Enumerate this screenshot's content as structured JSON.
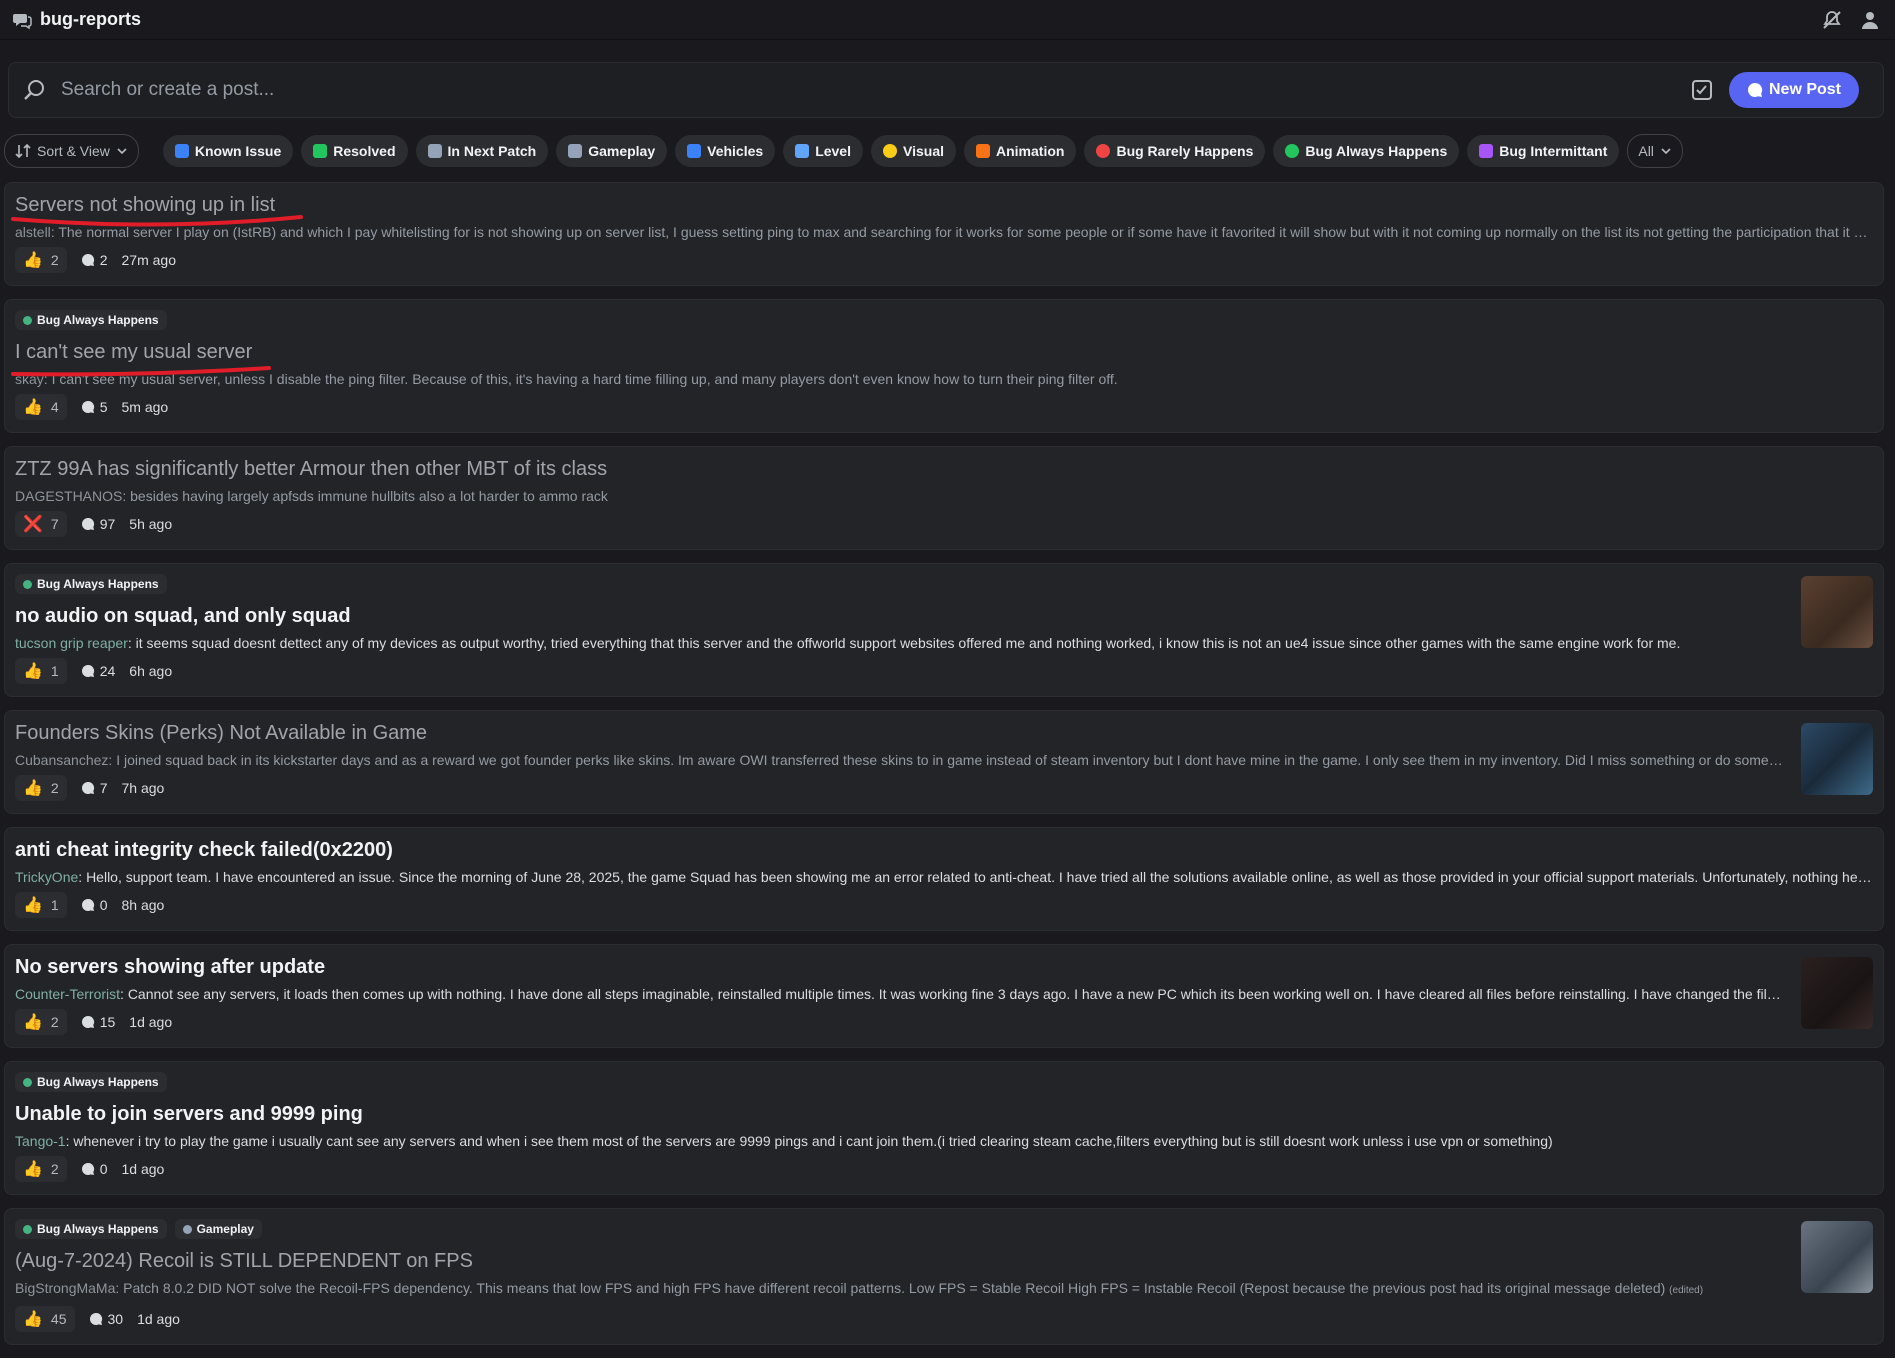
{
  "header": {
    "channel": "bug-reports",
    "icons": [
      "forum-icon",
      "mute-icon",
      "members-icon"
    ]
  },
  "search": {
    "placeholder": "Search or create a post...",
    "new_post_label": "New Post"
  },
  "sort_label": "Sort & View",
  "tags": [
    {
      "label": "Known Issue",
      "icon": "info-icon",
      "color": "#3b82f6"
    },
    {
      "label": "Resolved",
      "icon": "check-icon",
      "color": "#22c55e"
    },
    {
      "label": "In Next Patch",
      "icon": "patch-icon",
      "color": "#94a3b8"
    },
    {
      "label": "Gameplay",
      "icon": "dots-icon",
      "color": "#94a3b8"
    },
    {
      "label": "Vehicles",
      "icon": "vehicle-icon",
      "color": "#3b82f6"
    },
    {
      "label": "Level",
      "icon": "map-icon",
      "color": "#60a5fa"
    },
    {
      "label": "Visual",
      "icon": "bulb-icon",
      "color": "#facc15"
    },
    {
      "label": "Animation",
      "icon": "animation-icon",
      "color": "#f97316"
    },
    {
      "label": "Bug Rarely Happens",
      "icon": "red-bug-icon",
      "color": "#ef4444"
    },
    {
      "label": "Bug Always Happens",
      "icon": "green-bug-icon",
      "color": "#22c55e"
    },
    {
      "label": "Bug Intermittant",
      "icon": "worm-icon",
      "color": "#a855f7"
    }
  ],
  "all_label": "All",
  "posts": [
    {
      "tags": [],
      "title": "Servers not showing up in list",
      "dim": true,
      "author": "alstell",
      "preview": "The normal server I play on (IstRB) and which I pay whitelisting for is not showing up on server list, I guess setting ping to max and searching for it works for some people or if some have it favorited it will show but with it not coming up normally on the list its not getting the participation that it usually d...",
      "reaction": "👍",
      "reaction_count": "2",
      "comments": "2",
      "time": "27m ago",
      "thumb": null,
      "underline": true
    },
    {
      "tags": [
        "Bug Always Happens"
      ],
      "title": "I can't see my usual server",
      "dim": true,
      "author": "skay",
      "preview": "I can't see my usual server, unless I disable the ping filter. Because of this, it's having a hard time filling up, and many players don't even know how to turn their ping filter off.",
      "reaction": "👍",
      "reaction_count": "4",
      "comments": "5",
      "time": "5m ago",
      "thumb": null,
      "underline": true
    },
    {
      "tags": [],
      "title": "ZTZ 99A has significantly better Armour then other MBT of its class",
      "dim": true,
      "author": "DAGESTHANOS",
      "preview": "besides having largely apfsds immune hullbits also a lot harder to ammo rack",
      "reaction": "❌",
      "reaction_count": "7",
      "comments": "97",
      "time": "5h ago",
      "thumb": null
    },
    {
      "tags": [
        "Bug Always Happens"
      ],
      "title": "no audio on squad, and only squad",
      "dim": false,
      "author": "tucson grip reaper",
      "preview": "it seems squad doesnt dettect any of my devices as output worthy, tried everything that this server and the offworld support websites offered me and nothing worked, i know this is not an ue4 issue since other games with the same engine work for me.",
      "reaction": "👍",
      "reaction_count": "1",
      "comments": "24",
      "time": "6h ago",
      "thumb": "brown"
    },
    {
      "tags": [],
      "title": "Founders Skins (Perks) Not Available in Game",
      "dim": true,
      "author": "Cubansanchez",
      "preview": "I joined squad back in its kickstarter days and as a reward we got founder perks like skins. Im aware OWI transferred these skins to in game instead of steam inventory but I dont have mine in the game. I only see them in my inventory. Did I miss something or do something wrong. A...",
      "reaction": "👍",
      "reaction_count": "2",
      "comments": "7",
      "time": "7h ago",
      "thumb": "blue"
    },
    {
      "tags": [],
      "title": "anti cheat integrity check failed(0x2200)",
      "dim": false,
      "author": "TrickyOne",
      "preview": "Hello, support team. I have encountered an issue. Since the morning of June 28, 2025, the game Squad has been showing me an error related to anti-cheat. I have tried all the solutions available online, as well as those provided in your official support materials. Unfortunately, nothing helped. I woul...",
      "reaction": "👍",
      "reaction_count": "1",
      "comments": "0",
      "time": "8h ago",
      "thumb": null
    },
    {
      "tags": [],
      "title": "No servers showing after update",
      "dim": false,
      "author": "Counter-Terrorist",
      "preview": "Cannot see any servers, it loads then comes up with nothing. I have done all steps imaginable, reinstalled multiple times. It was working fine 3 days ago. I have a new PC which its been working well on. I have cleared all files before reinstalling. I have changed the filter settings, c...",
      "reaction": "👍",
      "reaction_count": "2",
      "comments": "15",
      "time": "1d ago",
      "thumb": "dark"
    },
    {
      "tags": [
        "Bug Always Happens"
      ],
      "title": "Unable to join servers and 9999 ping",
      "dim": false,
      "author": "Tango-1",
      "preview": "whenever i try to play the game i usually cant see any servers and when i see them most of the servers are 9999 pings and i cant join them.(i tried clearing steam cache,filters everything but is still doesnt work unless i use vpn or something)",
      "reaction": "👍",
      "reaction_count": "2",
      "comments": "0",
      "time": "1d ago",
      "thumb": null
    },
    {
      "tags": [
        "Bug Always Happens",
        "Gameplay"
      ],
      "title": "(Aug-7-2024) Recoil is STILL DEPENDENT on FPS",
      "dim": true,
      "author": "BigStrongMaMa",
      "preview": "Patch 8.0.2 DID NOT solve the Recoil-FPS dependency. This means that low FPS and high FPS have different recoil patterns. Low FPS = Stable Recoil High FPS = Instable Recoil (Repost because the previous post had its original message deleted)",
      "edited": "(edited)",
      "reaction": "👍",
      "reaction_count": "45",
      "comments": "30",
      "time": "1d ago",
      "thumb": "gray"
    }
  ]
}
